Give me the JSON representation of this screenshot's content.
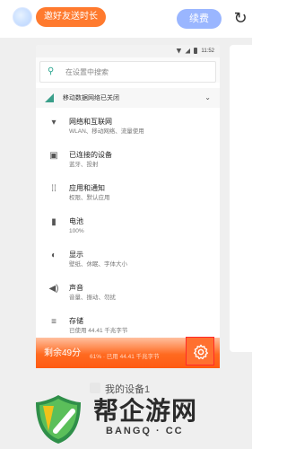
{
  "header": {
    "invite_label": "邀好友送时长",
    "renew_label": "续费",
    "refresh_icon": "refresh-icon"
  },
  "phone": {
    "status_time": "11:52",
    "search_placeholder": "在设置中搜索",
    "notice": "移动数据网络已关闭",
    "settings": [
      {
        "title": "网络和互联网",
        "sub": "WLAN、移动网络、流量使用",
        "icon": "wifi-icon"
      },
      {
        "title": "已连接的设备",
        "sub": "蓝牙、投射",
        "icon": "devices-icon"
      },
      {
        "title": "应用和通知",
        "sub": "权限、默认应用",
        "icon": "apps-icon"
      },
      {
        "title": "电池",
        "sub": "100%",
        "icon": "battery-icon"
      },
      {
        "title": "显示",
        "sub": "壁纸、休眠、字体大小",
        "icon": "display-icon"
      },
      {
        "title": "声音",
        "sub": "音量、振动、勿扰",
        "icon": "sound-icon"
      },
      {
        "title": "存储",
        "sub": "已使用 44.41 千兆字节",
        "icon": "storage-icon"
      }
    ]
  },
  "overlay": {
    "remaining_label": "剩余49分",
    "partial_text": "61% · 已用 44.41 千兆字节"
  },
  "device_label": "我的设备1",
  "watermark": {
    "title": "帮企游网",
    "subtitle": "BANGQ · CC"
  }
}
